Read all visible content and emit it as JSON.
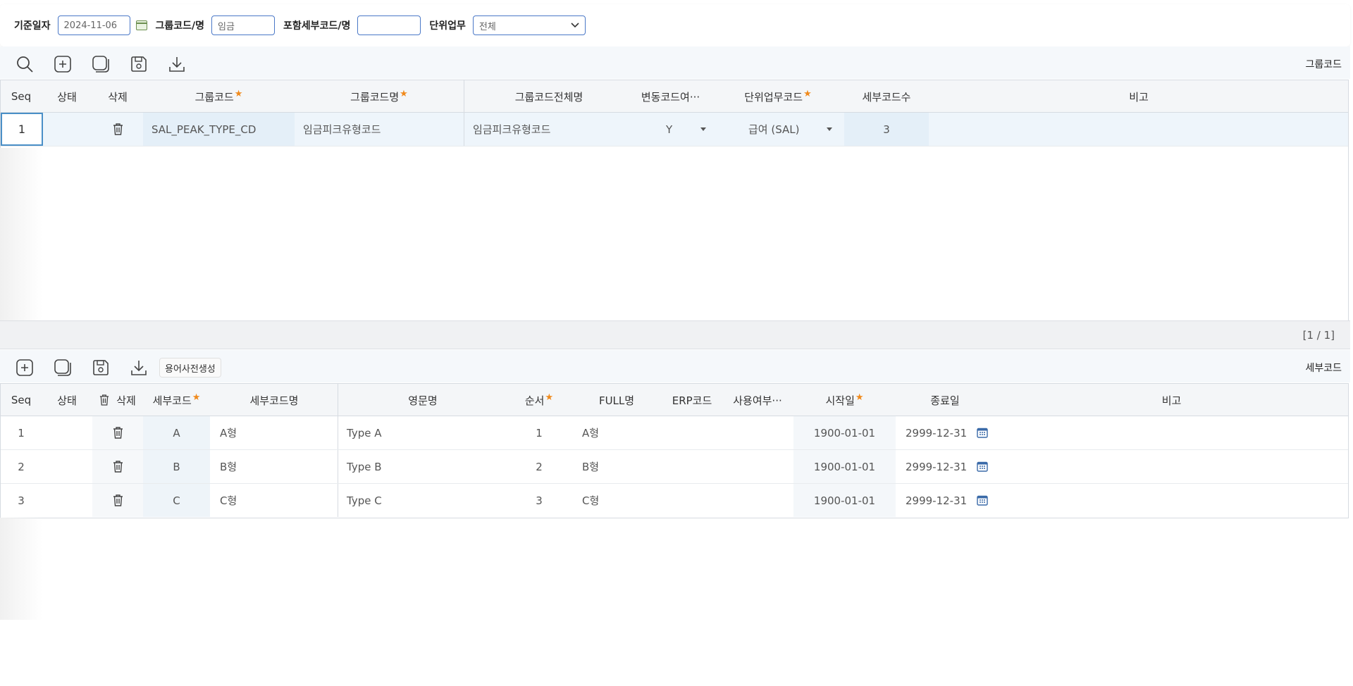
{
  "search": {
    "base_date_label": "기준일자",
    "base_date_value": "2024-11-06",
    "group_code_label": "그룹코드/명",
    "group_code_value": "임금",
    "detail_code_label": "포함세부코드/명",
    "detail_code_value": "",
    "unit_task_label": "단위업무",
    "unit_task_value": "전체"
  },
  "group_panel": {
    "title": "그룹코드",
    "columns": [
      "Seq",
      "상태",
      "삭제",
      "그룹코드",
      "그룹코드명",
      "그룹코드전체명",
      "변동코드여···",
      "단위업무코드",
      "세부코드수",
      "비고"
    ],
    "rows": [
      {
        "seq": "1",
        "status": "",
        "code": "SAL_PEAK_TYPE_CD",
        "name": "임금피크유형코드",
        "full_name": "임금피크유형코드",
        "variable": "Y",
        "unit_task": "급여 (SAL)",
        "detail_count": "3",
        "note": ""
      }
    ],
    "pager": "[1 / 1]"
  },
  "detail_panel": {
    "title": "세부코드",
    "term_button": "용어사전생성",
    "columns": [
      "Seq",
      "상태",
      "삭제",
      "세부코드",
      "세부코드명",
      "영문명",
      "순서",
      "FULL명",
      "ERP코드",
      "사용여부···",
      "시작일",
      "종료일",
      "비고"
    ],
    "rows": [
      {
        "seq": "1",
        "code": "A",
        "name": "A형",
        "eng": "Type A",
        "order": "1",
        "full": "A형",
        "erp": "",
        "use": "",
        "start": "1900-01-01",
        "end": "2999-12-31"
      },
      {
        "seq": "2",
        "code": "B",
        "name": "B형",
        "eng": "Type B",
        "order": "2",
        "full": "B형",
        "erp": "",
        "use": "",
        "start": "1900-01-01",
        "end": "2999-12-31"
      },
      {
        "seq": "3",
        "code": "C",
        "name": "C형",
        "eng": "Type C",
        "order": "3",
        "full": "C형",
        "erp": "",
        "use": "",
        "start": "1900-01-01",
        "end": "2999-12-31"
      }
    ]
  },
  "colors": {
    "accent_border": "#4a78c7",
    "required_star": "#f08a1c",
    "selected_row": "#eef5fb"
  }
}
